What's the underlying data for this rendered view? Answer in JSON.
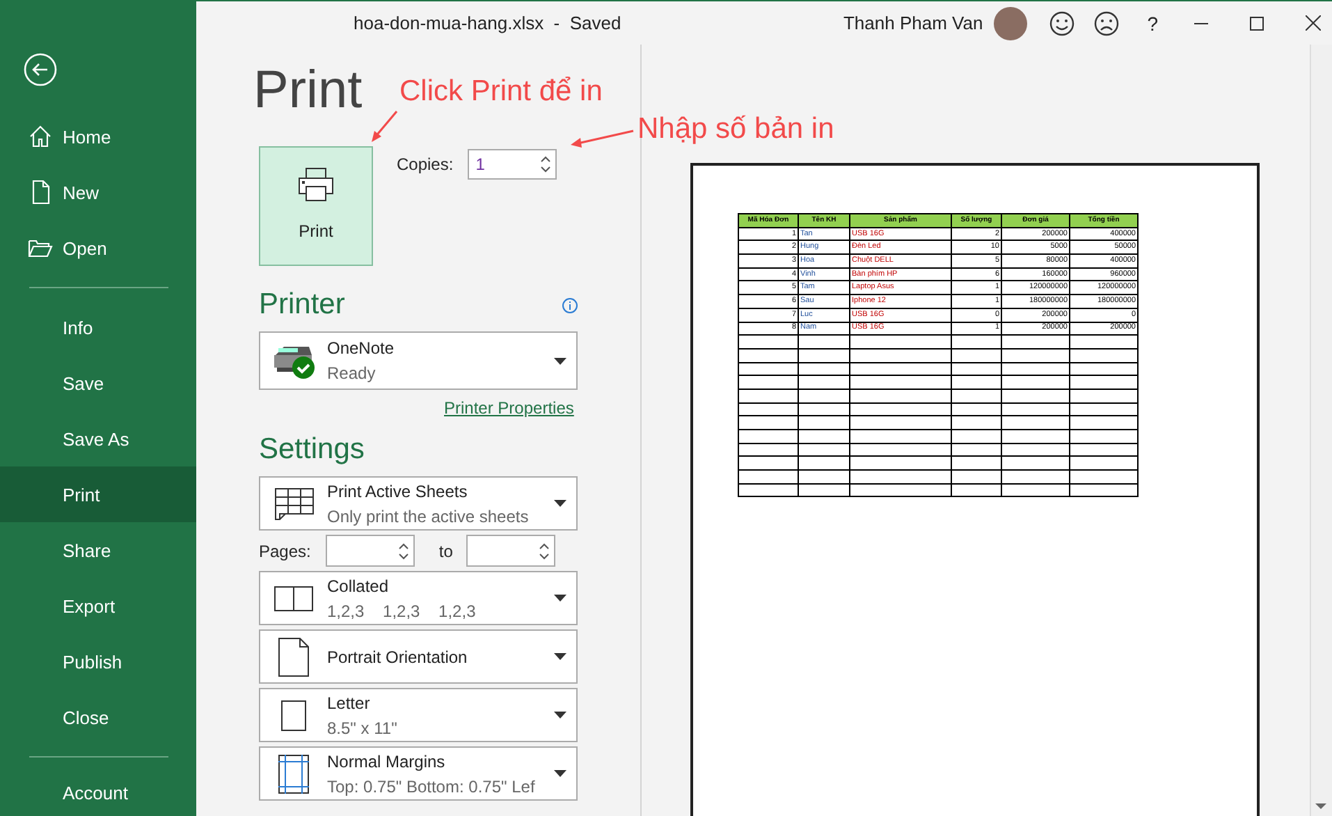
{
  "title_bar": {
    "title": "hoa-don-mua-hang.xlsx  -  Saved",
    "user": "Thanh Pham Van",
    "help": "?"
  },
  "sidebar": {
    "primary": [
      {
        "label": "Home",
        "kind": "home",
        "selected": false
      },
      {
        "label": "New",
        "kind": "new",
        "selected": false
      },
      {
        "label": "Open",
        "kind": "open",
        "selected": false
      }
    ],
    "items": [
      {
        "label": "Info",
        "selected": false
      },
      {
        "label": "Save",
        "selected": false
      },
      {
        "label": "Save As",
        "selected": false
      },
      {
        "label": "Print",
        "selected": true
      },
      {
        "label": "Share",
        "selected": false
      },
      {
        "label": "Export",
        "selected": false
      },
      {
        "label": "Publish",
        "selected": false
      },
      {
        "label": "Close",
        "selected": false
      }
    ],
    "footer": [
      {
        "label": "Account",
        "selected": false
      }
    ]
  },
  "print_panel": {
    "heading": "Print",
    "print_button": "Print",
    "copies": {
      "label": "Copies:",
      "value": "1"
    },
    "printer": {
      "heading": "Printer",
      "name": "OneNote",
      "status": "Ready",
      "properties_link": "Printer Properties"
    },
    "settings": {
      "heading": "Settings",
      "pages": {
        "label": "Pages:",
        "to": "to"
      },
      "options": [
        {
          "kind": "sheets",
          "title": "Print Active Sheets",
          "subtitle": "Only print the active sheets"
        },
        {
          "kind": "collated",
          "title": "Collated",
          "subtitle": "1,2,3    1,2,3    1,2,3"
        },
        {
          "kind": "orientation",
          "title": "Portrait Orientation"
        },
        {
          "kind": "paper",
          "title": "Letter",
          "subtitle": "8.5\" x 11\""
        },
        {
          "kind": "margins",
          "title": "Normal Margins",
          "subtitle": "Top: 0.75\" Bottom: 0.75\" Lef"
        }
      ]
    }
  },
  "preview": {
    "table": {
      "columns": [
        "Mã Hóa Đơn",
        "Tên KH",
        "Sản phẩm",
        "Số lượng",
        "Đơn giá",
        "Tổng tiền"
      ],
      "rows": [
        [
          "1",
          "Tan",
          "USB 16G",
          "2",
          "200000",
          "400000"
        ],
        [
          "2",
          "Hung",
          "Đèn Led",
          "10",
          "5000",
          "50000"
        ],
        [
          "3",
          "Hoa",
          "Chuột DELL",
          "5",
          "80000",
          "400000"
        ],
        [
          "4",
          "Vinh",
          "Bàn phím HP",
          "6",
          "160000",
          "960000"
        ],
        [
          "5",
          "Tam",
          "Laptop Asus",
          "1",
          "120000000",
          "120000000"
        ],
        [
          "6",
          "Sau",
          "Iphone 12",
          "1",
          "180000000",
          "180000000"
        ],
        [
          "7",
          "Luc",
          "USB 16G",
          "0",
          "200000",
          "0"
        ],
        [
          "8",
          "Nam",
          "USB 16G",
          "1",
          "200000",
          "200000"
        ]
      ]
    }
  },
  "annotations": [
    {
      "text": "Click Print để in"
    },
    {
      "text": "Nhập số bản in"
    }
  ]
}
